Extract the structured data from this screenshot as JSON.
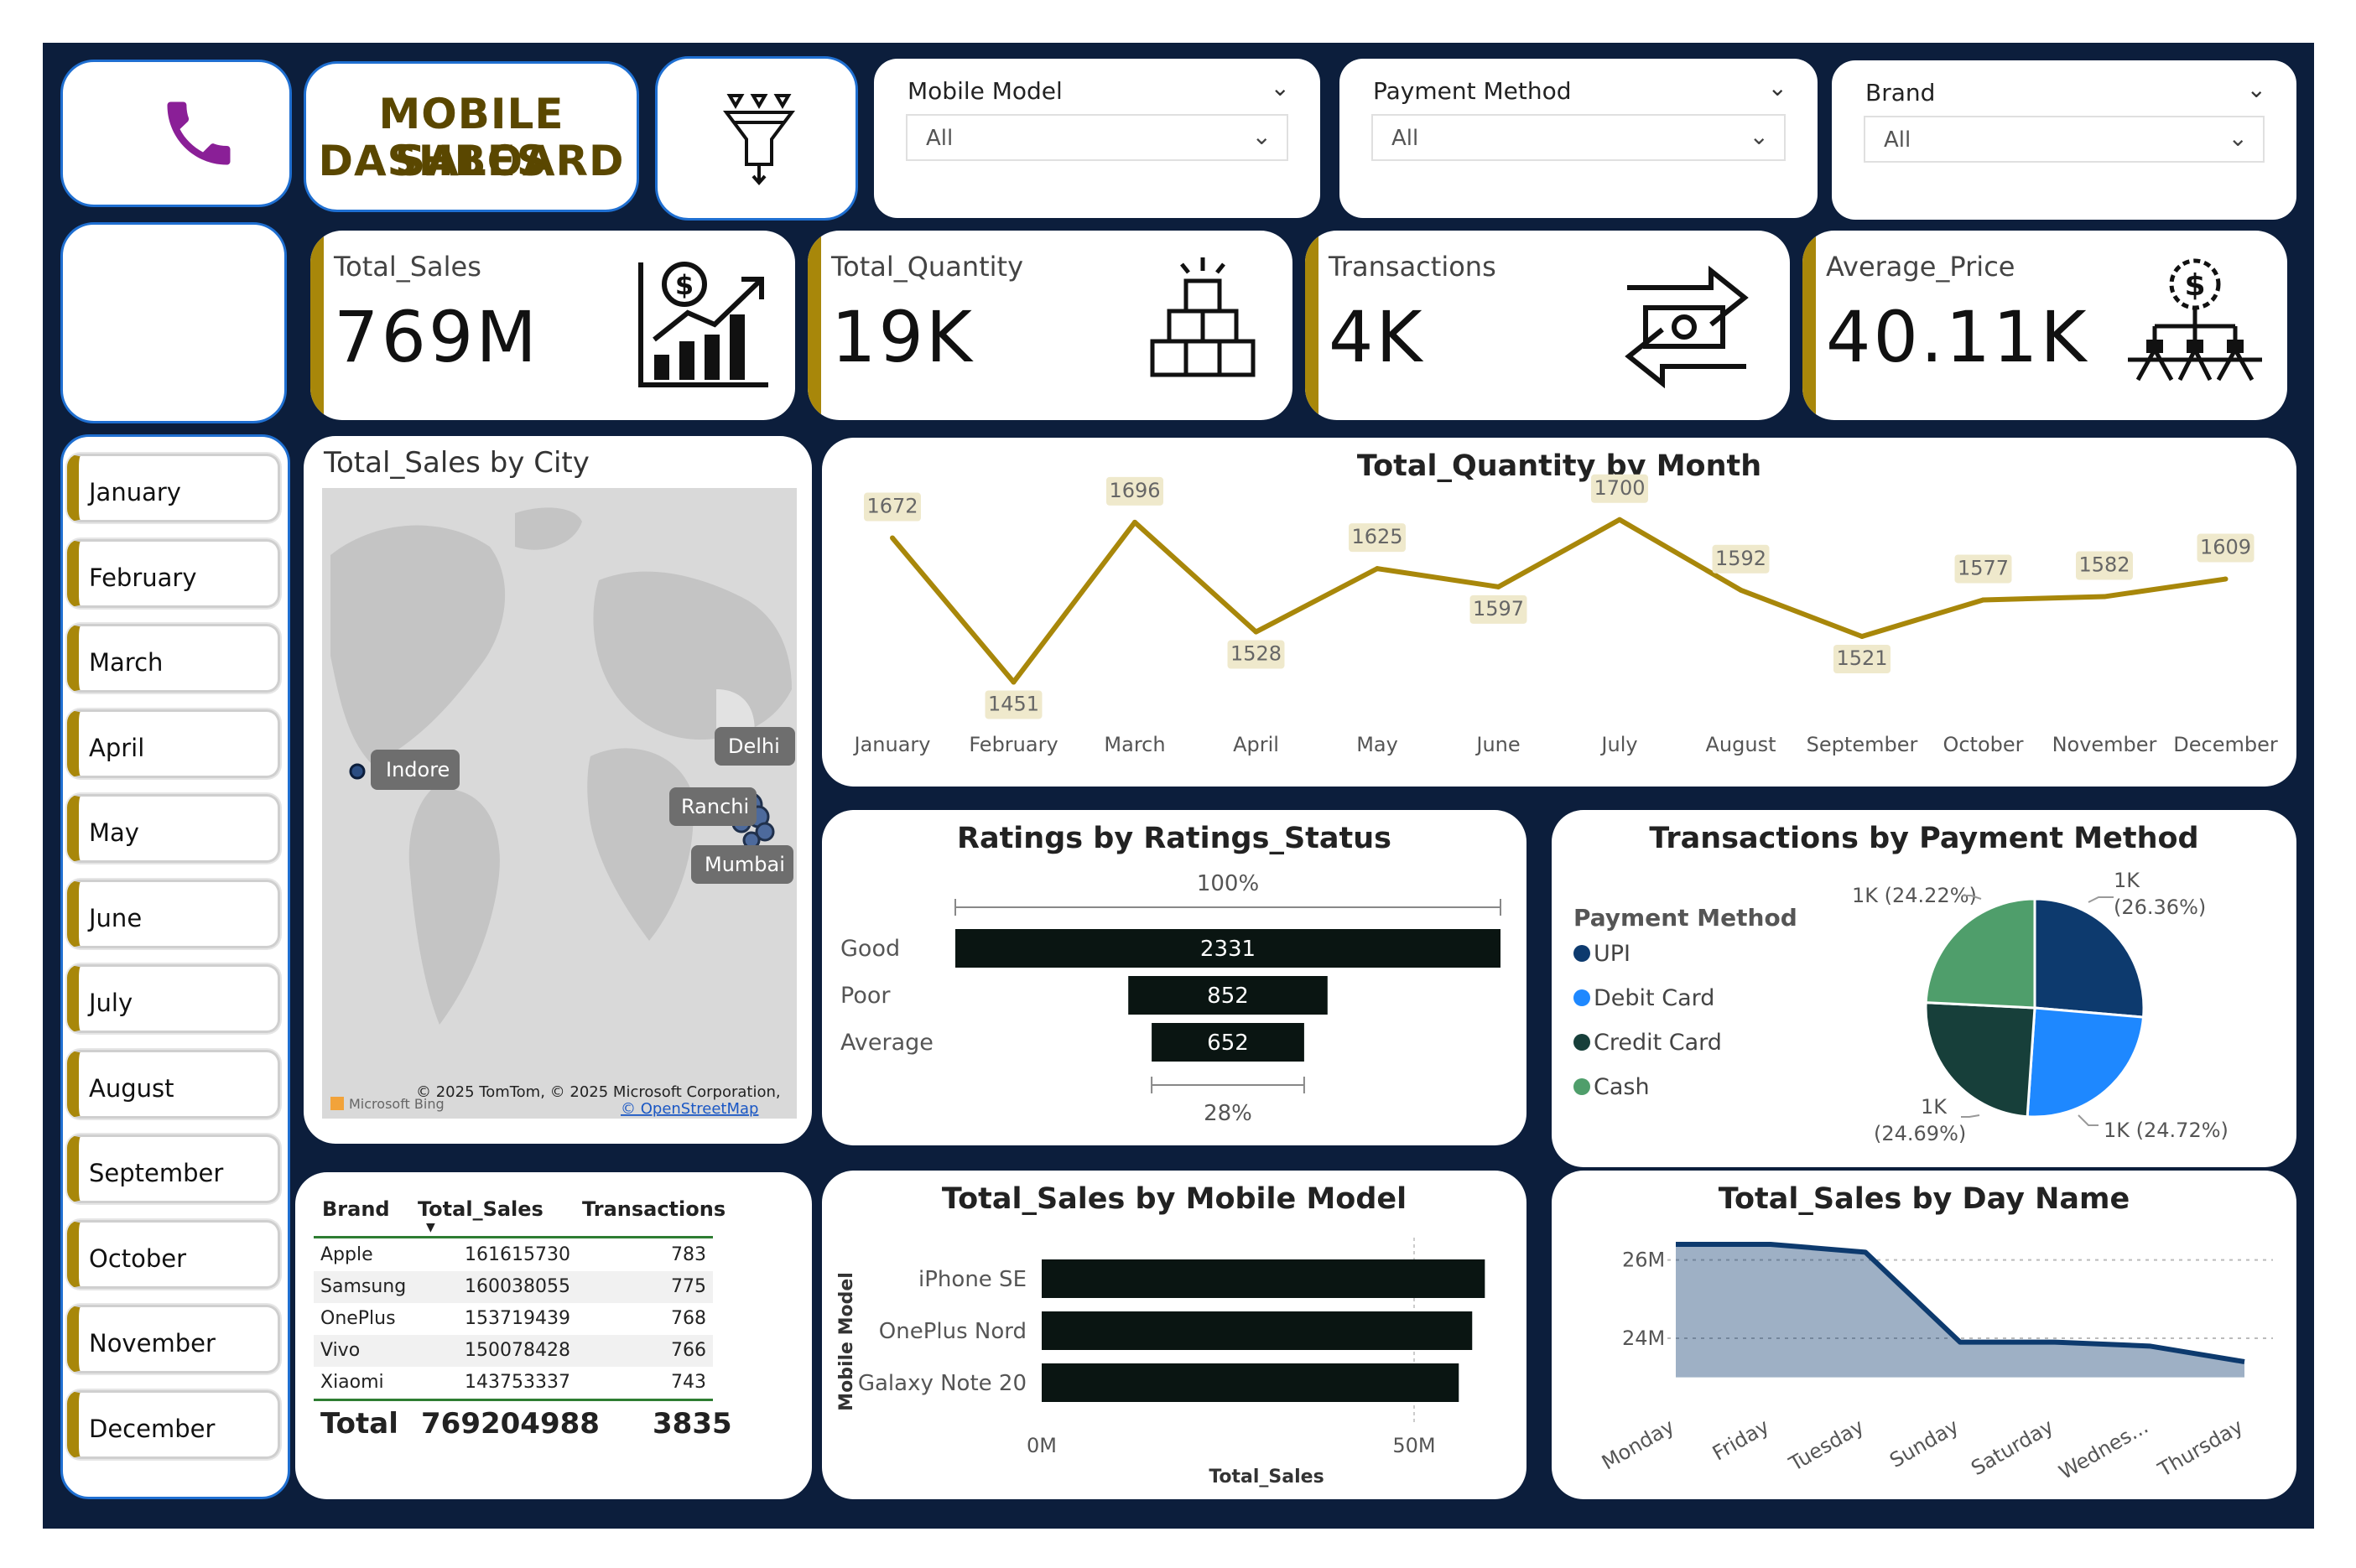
{
  "header": {
    "title_line1": "MOBILE SALES",
    "title_line2": "DASHBOARD"
  },
  "icons": {
    "phone": "phone-icon",
    "filter": "funnel-filter-icon"
  },
  "colors": {
    "navy": "#0c1e3c",
    "gold": "#a8870a",
    "olive_line": "#a8870a",
    "blue_border": "#1f6fd1",
    "area_fill": "#9fb1cc",
    "area_line": "#0d3a6e"
  },
  "slicers": {
    "mobile_model": {
      "label": "Mobile Model",
      "value": "All"
    },
    "payment_method": {
      "label": "Payment Method",
      "value": "All"
    },
    "brand": {
      "label": "Brand",
      "value": "All"
    }
  },
  "kpis": {
    "total_sales": {
      "label": "Total_Sales",
      "value": "769M"
    },
    "total_quantity": {
      "label": "Total_Quantity",
      "value": "19K"
    },
    "transactions": {
      "label": "Transactions",
      "value": "4K"
    },
    "average_price": {
      "label": "Average_Price",
      "value": "40.11K"
    }
  },
  "months": [
    "January",
    "February",
    "March",
    "April",
    "May",
    "June",
    "July",
    "August",
    "September",
    "October",
    "November",
    "December"
  ],
  "map": {
    "title": "Total_Sales by City",
    "cities": [
      "Indore",
      "Delhi",
      "Ranchi",
      "Mumbai"
    ],
    "attribution": "© 2025 TomTom, © 2025 Microsoft Corporation,",
    "osm": "© OpenStreetMap",
    "bing": "Microsoft Bing"
  },
  "table": {
    "headers": [
      "Brand",
      "Total_Sales",
      "Transactions"
    ],
    "rows": [
      [
        "Apple",
        "161615730",
        "783"
      ],
      [
        "Samsung",
        "160038055",
        "775"
      ],
      [
        "OnePlus",
        "153719439",
        "768"
      ],
      [
        "Vivo",
        "150078428",
        "766"
      ],
      [
        "Xiaomi",
        "143753337",
        "743"
      ]
    ],
    "total": [
      "Total",
      "769204988",
      "3835"
    ]
  },
  "chart_data": [
    {
      "type": "line",
      "title": "Total_Quantity by Month",
      "categories": [
        "January",
        "February",
        "March",
        "April",
        "May",
        "June",
        "July",
        "August",
        "September",
        "October",
        "November",
        "December"
      ],
      "values": [
        1672,
        1451,
        1696,
        1528,
        1625,
        1597,
        1700,
        1592,
        1521,
        1577,
        1582,
        1609
      ],
      "data_labels": [
        "1672",
        "1451",
        "1696",
        "1528",
        "1625",
        "1597",
        "1700",
        "1592",
        "1521",
        "1577",
        "1582",
        "1609"
      ],
      "color": "#a8870a"
    },
    {
      "type": "bar",
      "title": "Ratings by Ratings_Status",
      "categories": [
        "Good",
        "Poor",
        "Average"
      ],
      "values": [
        2331,
        852,
        652
      ],
      "top_label": "100%",
      "bottom_label": "28%",
      "color": "#0a1512"
    },
    {
      "type": "pie",
      "title": "Transactions by Payment Method",
      "legend_title": "Payment Method",
      "categories": [
        "UPI",
        "Debit Card",
        "Credit Card",
        "Cash"
      ],
      "values": [
        26.36,
        24.72,
        24.69,
        24.22
      ],
      "labels": [
        "1K (26.36%)",
        "1K (24.72%)",
        "1K (24.69%)",
        "1K (24.22%)"
      ],
      "colors": [
        "#0d3a6e",
        "#1e88ff",
        "#173f3a",
        "#4f9e6b"
      ]
    },
    {
      "type": "bar",
      "title": "Total_Sales by Mobile Model",
      "categories": [
        "iPhone SE",
        "OnePlus Nord",
        "Galaxy Note 20"
      ],
      "values": [
        59.5,
        57.8,
        56.0
      ],
      "xlabel": "Total_Sales",
      "ylabel": "Mobile Model",
      "xticks": [
        "0M",
        "50M"
      ],
      "xlim": [
        0,
        65
      ],
      "color": "#0a1512"
    },
    {
      "type": "area",
      "title": "Total_Sales by Day Name",
      "categories": [
        "Monday",
        "Friday",
        "Tuesday",
        "Sunday",
        "Saturday",
        "Wednes...",
        "Thursday"
      ],
      "values": [
        26.4,
        26.4,
        26.2,
        23.9,
        23.9,
        23.8,
        23.4
      ],
      "yticks": [
        "26M",
        "24M"
      ],
      "ylim": [
        22.5,
        27
      ],
      "color": "#0d3a6e"
    }
  ]
}
